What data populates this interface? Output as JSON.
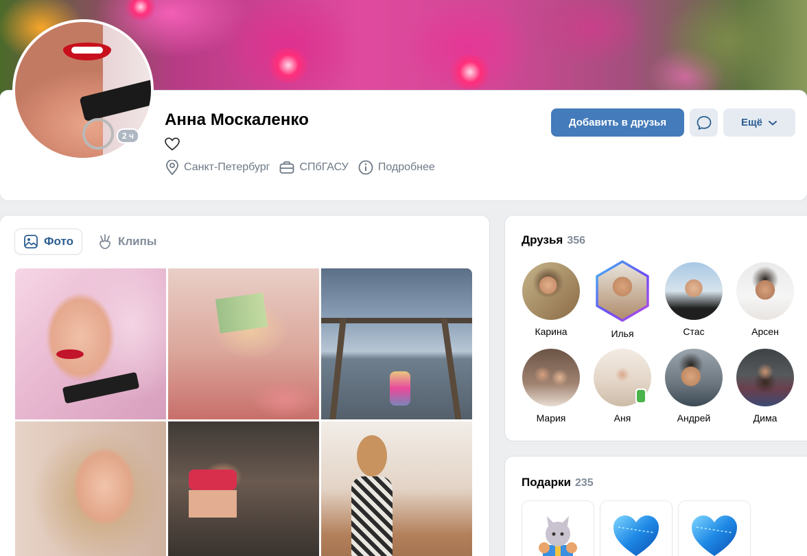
{
  "profile": {
    "name": "Анна Москаленко",
    "online_status": "2 ч",
    "city": "Санкт-Петербург",
    "university": "СПбГАСУ",
    "more_info": "Подробнее"
  },
  "actions": {
    "add_friend": "Добавить в друзья",
    "more": "Ещё"
  },
  "media_tabs": [
    {
      "label": "Фото",
      "active": true,
      "icon": "photo-icon"
    },
    {
      "label": "Клипы",
      "active": false,
      "icon": "clips-icon"
    }
  ],
  "friends": {
    "title": "Друзья",
    "count": "356",
    "items": [
      {
        "name": "Карина"
      },
      {
        "name": "Илья"
      },
      {
        "name": "Стас"
      },
      {
        "name": "Арсен"
      },
      {
        "name": "Мария"
      },
      {
        "name": "Аня"
      },
      {
        "name": "Андрей"
      },
      {
        "name": "Дима"
      }
    ]
  },
  "gifts": {
    "title": "Подарки",
    "count": "235"
  },
  "colors": {
    "accent": "#447bba",
    "secondary_button_bg": "#e5ebf1",
    "secondary_button_text": "#2c5d8f",
    "muted_text": "#818c99",
    "page_bg": "#edeef0"
  }
}
